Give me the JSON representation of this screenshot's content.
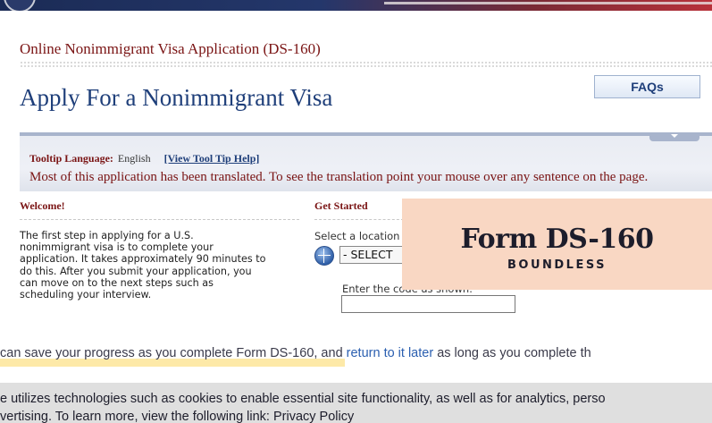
{
  "header": {
    "app_title": "Online Nonimmigrant Visa Application (DS-160)",
    "page_title": "Apply For a Nonimmigrant Visa",
    "faq_label": "FAQs"
  },
  "tooltip": {
    "label": "Tooltip Language:",
    "language": "English",
    "help_link": "[View Tool Tip Help]",
    "message": "Most of this application has been translated. To see the translation point your mouse over any sentence on the page."
  },
  "welcome": {
    "heading": "Welcome!",
    "lines": [
      "The first step in applying for a U.S.",
      "nonimmigrant visa is to complete your",
      "application. It takes approximately 90 minutes to",
      "do this. After you submit your application, you",
      "can move on to the next steps such as",
      "scheduling your interview."
    ]
  },
  "get_started": {
    "heading": "Get Started",
    "select_label": "Select a location",
    "select_value": "- SELECT",
    "captcha_label": "Enter the code as shown:"
  },
  "overlay": {
    "title": "Form DS-160",
    "subtitle": "BOUNDLESS",
    "bg_color": "#f9d7c3"
  },
  "caption": {
    "part1": "can save your progress as you complete Form DS-160, and ",
    "link": "return to it later",
    "part2": " as long as you complete th"
  },
  "cookie": {
    "line1": "e utilizes technologies such as cookies to enable essential site functionality, as well as for analytics, perso",
    "line2_prefix": "vertising. To learn more, view the following link: ",
    "privacy_link": "Privacy Policy"
  },
  "colors": {
    "maroon": "#7a1414",
    "navy": "#1f3f7a",
    "link_blue": "#2b5fb0"
  },
  "icons": [
    "seal-icon",
    "globe-icon",
    "dropdown-arrow-icon"
  ]
}
